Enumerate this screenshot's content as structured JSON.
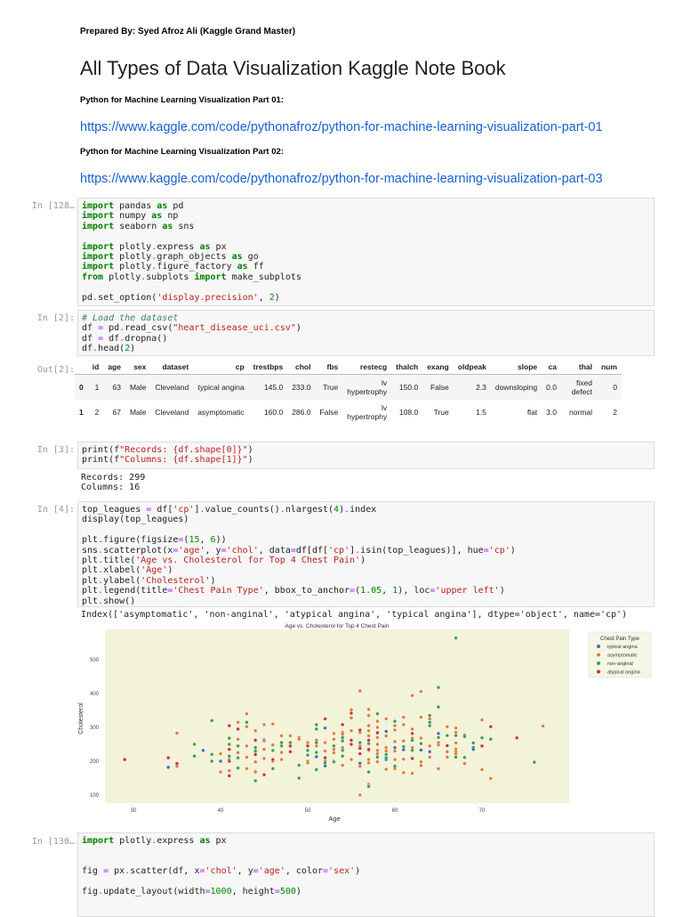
{
  "header": {
    "prepared_by": "Prepared By: Syed Afroz Ali (Kaggle Grand Master)",
    "title": "All Types of Data Visualization Kaggle Note Book",
    "part1_label": "Python for Machine Learning Visualization Part 01:",
    "part1_link": "https://www.kaggle.com/code/pythonafroz/python-for-machine-learning-visualization-part-01",
    "part2_label": "Python for Machine Learning Visualization Part 02:",
    "part2_link": "https://www.kaggle.com/code/pythonafroz/python-for-machine-learning-visualization-part-03"
  },
  "cells": [
    {
      "prompt": "In [128…",
      "lines": [
        "import pandas as pd",
        "import numpy as np",
        "import seaborn as sns",
        "",
        "import plotly.express as px",
        "import plotly.graph_objects as go",
        "import plotly.figure_factory as ff",
        "from plotly.subplots import make_subplots",
        "",
        "pd.set_option('display.precision', 2)"
      ]
    },
    {
      "prompt": "In [2]:",
      "lines": [
        "# Load the dataset",
        "df = pd.read_csv(\"heart_disease_uci.csv\")",
        "df = df.dropna()",
        "df.head(2)"
      ]
    },
    {
      "prompt": "In [3]:",
      "lines": [
        "print(f\"Records: {df.shape[0]}\")",
        "print(f\"Columns: {df.shape[1]}\")"
      ],
      "output": [
        "Records: 299",
        "Columns: 16"
      ]
    },
    {
      "prompt": "In [4]:",
      "lines": [
        "top_leagues = df['cp'].value_counts().nlargest(4).index",
        "display(top_leagues)",
        "",
        "plt.figure(figsize=(15, 6))",
        "sns.scatterplot(x='age', y='chol', data=df[df['cp'].isin(top_leagues)], hue='cp')",
        "plt.title('Age vs. Cholesterol for Top 4 Chest Pain')",
        "plt.xlabel('Age')",
        "plt.ylabel('Cholesterol')",
        "plt.legend(title='Chest Pain Type', bbox_to_anchor=(1.05, 1), loc='upper left')",
        "plt.show()"
      ],
      "output": [
        "Index(['asymptomatic', 'non-anginal', 'atypical angina', 'typical angina'], dtype='object', name='cp')"
      ]
    },
    {
      "prompt": "In [130…",
      "lines": [
        "import plotly.express as px",
        "",
        "",
        "fig = px.scatter(df, x='chol', y='age', color='sex')",
        "",
        "fig.update_layout(width=1000, height=500)"
      ]
    }
  ],
  "table": {
    "out_prompt": "Out[2]:",
    "columns": [
      "",
      "id",
      "age",
      "sex",
      "dataset",
      "cp",
      "trestbps",
      "chol",
      "fbs",
      "restecg",
      "thalch",
      "exang",
      "oldpeak",
      "slope",
      "ca",
      "thal",
      "num"
    ],
    "rows": [
      [
        "0",
        "1",
        "63",
        "Male",
        "Cleveland",
        "typical angina",
        "145.0",
        "233.0",
        "True",
        "lv hypertrophy",
        "150.0",
        "False",
        "2.3",
        "downsloping",
        "0.0",
        "fixed defect",
        "0"
      ],
      [
        "1",
        "2",
        "67",
        "Male",
        "Cleveland",
        "asymptomatic",
        "160.0",
        "286.0",
        "False",
        "lv hypertrophy",
        "108.0",
        "True",
        "1.5",
        "flat",
        "3.0",
        "normal",
        "2"
      ]
    ]
  },
  "chart_data": {
    "type": "scatter",
    "title": "Age vs. Cholesterol for Top 4 Chest Pain",
    "xlabel": "Age",
    "ylabel": "Cholesterol",
    "xlim": [
      27,
      80
    ],
    "ylim": [
      80,
      580
    ],
    "xticks": [
      30,
      40,
      50,
      60,
      70
    ],
    "yticks": [
      100,
      200,
      300,
      400,
      500
    ],
    "grid": false,
    "background": "#f3f3d9",
    "legend": {
      "title": "Chest Pain Type",
      "placement": "outside-top-right"
    },
    "series": [
      {
        "name": "typical angina",
        "color": "#3b6fb6",
        "points": [
          [
            34,
            182
          ],
          [
            38,
            232
          ],
          [
            40,
            200
          ],
          [
            45,
            263
          ],
          [
            51,
            213
          ],
          [
            52,
            298
          ],
          [
            52,
            186
          ],
          [
            56,
            194
          ],
          [
            59,
            288
          ],
          [
            59,
            205
          ],
          [
            60,
            240
          ],
          [
            61,
            234
          ],
          [
            63,
            233
          ],
          [
            64,
            228
          ],
          [
            65,
            282
          ],
          [
            69,
            240
          ],
          [
            69,
            235
          ]
        ]
      },
      {
        "name": "asymptomatic",
        "color": "#e07b39",
        "points": [
          [
            35,
            283
          ],
          [
            35,
            190
          ],
          [
            35,
            185
          ],
          [
            40,
            222
          ],
          [
            40,
            168
          ],
          [
            41,
            172
          ],
          [
            41,
            205
          ],
          [
            42,
            315
          ],
          [
            42,
            265
          ],
          [
            42,
            225
          ],
          [
            43,
            340
          ],
          [
            43,
            302
          ],
          [
            43,
            245
          ],
          [
            43,
            212
          ],
          [
            43,
            178
          ],
          [
            44,
            290
          ],
          [
            44,
            198
          ],
          [
            44,
            170
          ],
          [
            44,
            168
          ],
          [
            45,
            308
          ],
          [
            45,
            260
          ],
          [
            45,
            235
          ],
          [
            45,
            208
          ],
          [
            46,
            310
          ],
          [
            46,
            248
          ],
          [
            46,
            200
          ],
          [
            47,
            275
          ],
          [
            47,
            226
          ],
          [
            47,
            205
          ],
          [
            48,
            275
          ],
          [
            48,
            255
          ],
          [
            49,
            270
          ],
          [
            49,
            265
          ],
          [
            50,
            255
          ],
          [
            50,
            200
          ],
          [
            50,
            195
          ],
          [
            51,
            262
          ],
          [
            51,
            245
          ],
          [
            52,
            255
          ],
          [
            52,
            230
          ],
          [
            52,
            200
          ],
          [
            53,
            282
          ],
          [
            53,
            265
          ],
          [
            53,
            235
          ],
          [
            53,
            225
          ],
          [
            53,
            200
          ],
          [
            54,
            285
          ],
          [
            54,
            280
          ],
          [
            54,
            240
          ],
          [
            54,
            188
          ],
          [
            55,
            352
          ],
          [
            55,
            328
          ],
          [
            55,
            290
          ],
          [
            55,
            205
          ],
          [
            56,
            408
          ],
          [
            56,
            285
          ],
          [
            56,
            245
          ],
          [
            56,
            185
          ],
          [
            56,
            100
          ],
          [
            57,
            353
          ],
          [
            57,
            335
          ],
          [
            57,
            305
          ],
          [
            57,
            290
          ],
          [
            57,
            275
          ],
          [
            57,
            232
          ],
          [
            57,
            205
          ],
          [
            57,
            195
          ],
          [
            57,
            132
          ],
          [
            57,
            128
          ],
          [
            58,
            318
          ],
          [
            58,
            300
          ],
          [
            58,
            270
          ],
          [
            58,
            250
          ],
          [
            58,
            232
          ],
          [
            58,
            222
          ],
          [
            58,
            198
          ],
          [
            59,
            325
          ],
          [
            59,
            275
          ],
          [
            59,
            240
          ],
          [
            59,
            230
          ],
          [
            59,
            176
          ],
          [
            60,
            305
          ],
          [
            60,
            292
          ],
          [
            60,
            258
          ],
          [
            60,
            230
          ],
          [
            60,
            205
          ],
          [
            60,
            178
          ],
          [
            61,
            330
          ],
          [
            61,
            308
          ],
          [
            61,
            260
          ],
          [
            61,
            206
          ],
          [
            61,
            166
          ],
          [
            62,
            394
          ],
          [
            62,
            295
          ],
          [
            62,
            268
          ],
          [
            62,
            240
          ],
          [
            62,
            164
          ],
          [
            63,
            406
          ],
          [
            63,
            330
          ],
          [
            63,
            268
          ],
          [
            63,
            198
          ],
          [
            63,
            187
          ],
          [
            64,
            325
          ],
          [
            64,
            245
          ],
          [
            64,
            212
          ],
          [
            65,
            255
          ],
          [
            65,
            248
          ],
          [
            65,
            178
          ],
          [
            66,
            302
          ],
          [
            66,
            228
          ],
          [
            66,
            212
          ],
          [
            67,
            298
          ],
          [
            67,
            285
          ],
          [
            67,
            254
          ],
          [
            67,
            236
          ],
          [
            67,
            228
          ],
          [
            67,
            222
          ],
          [
            68,
            193
          ],
          [
            70,
            322
          ],
          [
            70,
            175
          ],
          [
            71,
            149
          ],
          [
            77,
            304
          ]
        ]
      },
      {
        "name": "non-anginal",
        "color": "#3a9e55",
        "points": [
          [
            37,
            250
          ],
          [
            37,
            215
          ],
          [
            39,
            320
          ],
          [
            39,
            220
          ],
          [
            39,
            200
          ],
          [
            41,
            268
          ],
          [
            41,
            250
          ],
          [
            41,
            215
          ],
          [
            42,
            245
          ],
          [
            42,
            210
          ],
          [
            42,
            180
          ],
          [
            43,
            315
          ],
          [
            44,
            240
          ],
          [
            44,
            230
          ],
          [
            44,
            220
          ],
          [
            44,
            142
          ],
          [
            46,
            232
          ],
          [
            46,
            178
          ],
          [
            47,
            255
          ],
          [
            47,
            245
          ],
          [
            48,
            255
          ],
          [
            49,
            188
          ],
          [
            49,
            150
          ],
          [
            50,
            232
          ],
          [
            50,
            218
          ],
          [
            51,
            308
          ],
          [
            51,
            295
          ],
          [
            51,
            255
          ],
          [
            51,
            226
          ],
          [
            51,
            175
          ],
          [
            52,
            195
          ],
          [
            53,
            245
          ],
          [
            53,
            198
          ],
          [
            54,
            270
          ],
          [
            54,
            260
          ],
          [
            54,
            232
          ],
          [
            54,
            215
          ],
          [
            56,
            255
          ],
          [
            57,
            252
          ],
          [
            57,
            168
          ],
          [
            57,
            125
          ],
          [
            58,
            340
          ],
          [
            58,
            212
          ],
          [
            59,
            220
          ],
          [
            59,
            210
          ],
          [
            60,
            318
          ],
          [
            60,
            185
          ],
          [
            61,
            243
          ],
          [
            62,
            262
          ],
          [
            62,
            232
          ],
          [
            63,
            252
          ],
          [
            64,
            335
          ],
          [
            64,
            315
          ],
          [
            64,
            305
          ],
          [
            65,
            418
          ],
          [
            65,
            360
          ],
          [
            65,
            270
          ],
          [
            66,
            276
          ],
          [
            67,
            564
          ],
          [
            67,
            276
          ],
          [
            67,
            212
          ],
          [
            68,
            277
          ],
          [
            68,
            273
          ],
          [
            68,
            211
          ],
          [
            69,
            254
          ],
          [
            70,
            269
          ],
          [
            71,
            265
          ],
          [
            76,
            197
          ]
        ]
      },
      {
        "name": "atypical angina",
        "color": "#c7323f",
        "points": [
          [
            29,
            205
          ],
          [
            34,
            210
          ],
          [
            35,
            193
          ],
          [
            41,
            305
          ],
          [
            41,
            235
          ],
          [
            41,
            200
          ],
          [
            41,
            157
          ],
          [
            42,
            295
          ],
          [
            44,
            262
          ],
          [
            44,
            220
          ],
          [
            45,
            160
          ],
          [
            46,
            205
          ],
          [
            48,
            245
          ],
          [
            48,
            228
          ],
          [
            50,
            245
          ],
          [
            52,
            325
          ],
          [
            52,
            210
          ],
          [
            54,
            308
          ],
          [
            55,
            342
          ],
          [
            55,
            262
          ],
          [
            55,
            250
          ],
          [
            56,
            292
          ],
          [
            56,
            238
          ],
          [
            56,
            222
          ],
          [
            57,
            262
          ],
          [
            57,
            235
          ],
          [
            58,
            284
          ],
          [
            62,
            282
          ],
          [
            62,
            208
          ],
          [
            66,
            246
          ],
          [
            70,
            245
          ],
          [
            71,
            302
          ],
          [
            74,
            269
          ]
        ]
      }
    ]
  }
}
